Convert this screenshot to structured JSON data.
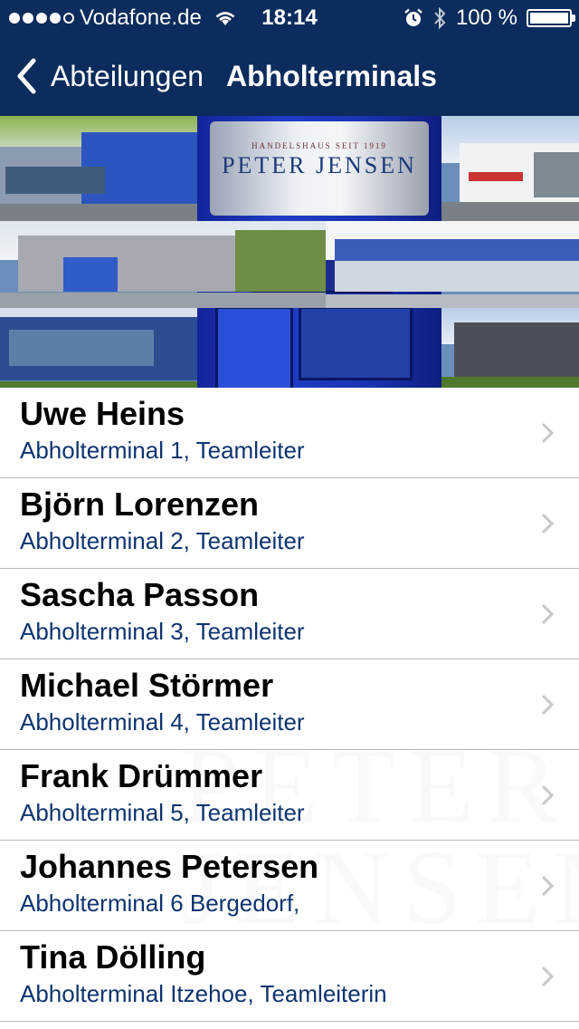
{
  "status_bar": {
    "carrier": "Vodafone.de",
    "time": "18:14",
    "battery": "100 %",
    "signal_bars_filled": 4,
    "signal_bars_total": 5
  },
  "nav": {
    "back_label": "Abteilungen",
    "title": "Abholterminals"
  },
  "header_image": {
    "sign_small_text": "HANDELSHAUS SEIT 1919",
    "sign_name": "PETER JENSEN"
  },
  "contacts": [
    {
      "name": "Uwe Heins",
      "subtitle": "Abholterminal 1, Teamleiter"
    },
    {
      "name": "Björn Lorenzen",
      "subtitle": "Abholterminal 2, Teamleiter"
    },
    {
      "name": "Sascha Passon",
      "subtitle": "Abholterminal 3, Teamleiter"
    },
    {
      "name": "Michael Störmer",
      "subtitle": "Abholterminal 4, Teamleiter"
    },
    {
      "name": "Frank Drümmer",
      "subtitle": "Abholterminal 5, Teamleiter"
    },
    {
      "name": "Johannes Petersen",
      "subtitle": "Abholterminal 6 Bergedorf,"
    },
    {
      "name": "Tina Dölling",
      "subtitle": "Abholterminal Itzehoe, Teamleiterin"
    }
  ],
  "watermark": {
    "line1": "PETER",
    "line2": "JENSEN"
  },
  "colors": {
    "bar_background": "#0b2c5c",
    "subtitle_text": "#0e3470",
    "chevron": "#c7c7cc"
  },
  "icons": {
    "back": "chevron-left-icon",
    "disclosure": "chevron-right-icon",
    "wifi": "wifi-icon",
    "alarm": "alarm-icon",
    "bluetooth": "bluetooth-icon",
    "battery": "battery-icon"
  }
}
